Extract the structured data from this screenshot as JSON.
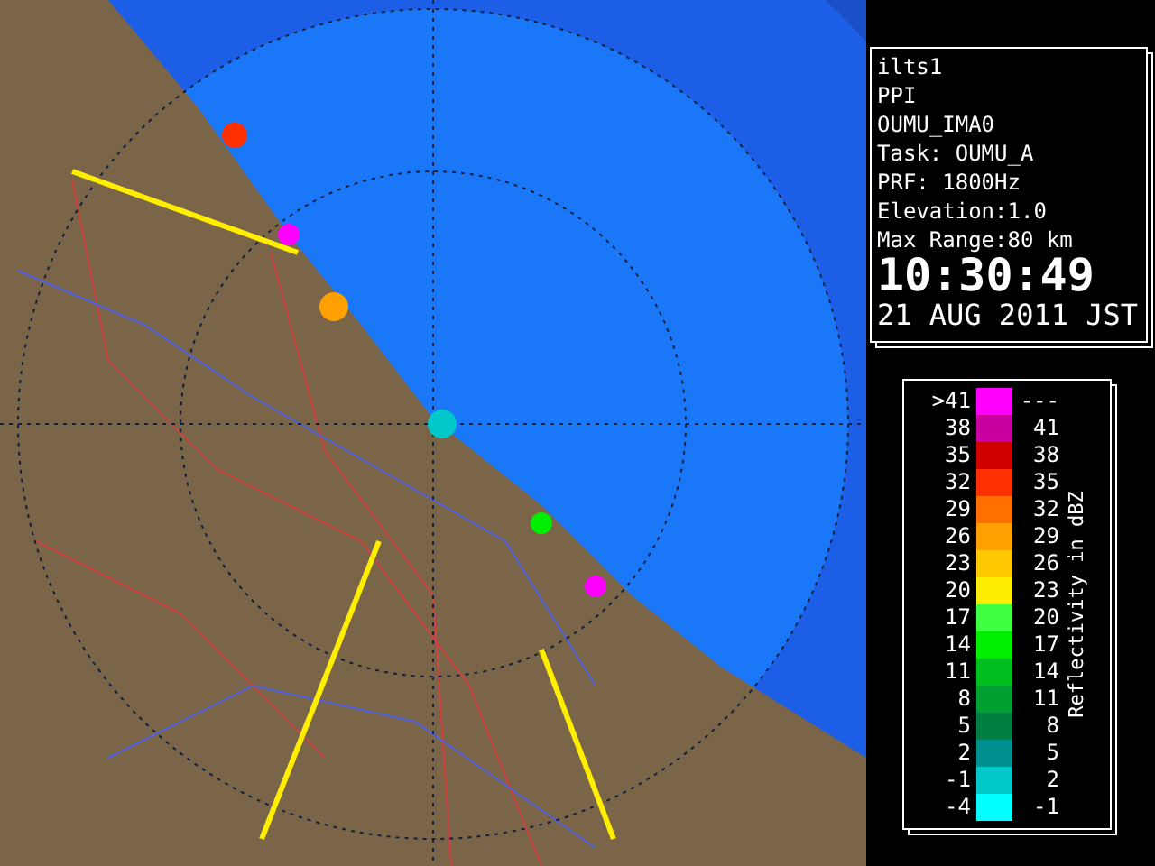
{
  "info": {
    "lines": [
      "ilts1",
      "PPI",
      "OUMU_IMA0",
      "Task: OUMU_A",
      "PRF: 1800Hz",
      "Elevation:1.0",
      "Max Range:80 km"
    ],
    "time": "10:30:49",
    "date": "21 AUG 2011 JST"
  },
  "legend": {
    "title": "Reflectivity in dBZ",
    "rows": [
      {
        "low": ">41",
        "high": "---",
        "color": "#ff00ff"
      },
      {
        "low": "38",
        "high": "41",
        "color": "#c800a0"
      },
      {
        "low": "35",
        "high": "38",
        "color": "#d00000"
      },
      {
        "low": "32",
        "high": "35",
        "color": "#ff3000"
      },
      {
        "low": "29",
        "high": "32",
        "color": "#ff7000"
      },
      {
        "low": "26",
        "high": "29",
        "color": "#ffa000"
      },
      {
        "low": "23",
        "high": "26",
        "color": "#ffc800"
      },
      {
        "low": "20",
        "high": "23",
        "color": "#ffee00"
      },
      {
        "low": "17",
        "high": "20",
        "color": "#40ff40"
      },
      {
        "low": "14",
        "high": "17",
        "color": "#00ee00"
      },
      {
        "low": "11",
        "high": "14",
        "color": "#00c020"
      },
      {
        "low": "8",
        "high": "11",
        "color": "#00a030"
      },
      {
        "low": "5",
        "high": "8",
        "color": "#008040"
      },
      {
        "low": "2",
        "high": "5",
        "color": "#009090"
      },
      {
        "low": "-1",
        "high": "2",
        "color": "#00c8c8"
      },
      {
        "low": "-4",
        "high": "-1",
        "color": "#00ffff"
      }
    ]
  }
}
